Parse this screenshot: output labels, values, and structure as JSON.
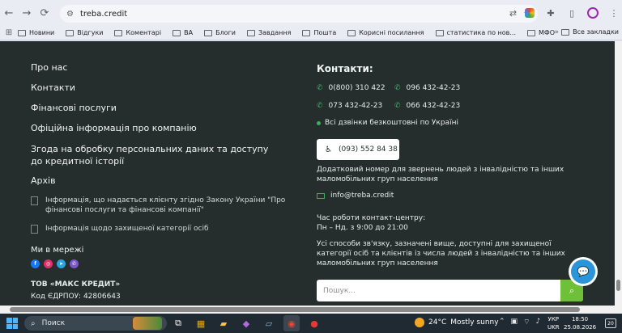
{
  "browser": {
    "url": "treba.credit",
    "bookmarks": [
      "Новини",
      "Відгуки",
      "Коментарі",
      "ВА",
      "Блоги",
      "Завдання",
      "Пошта",
      "Корисні посилання",
      "статистика по нов...",
      "МФО"
    ],
    "more": "»",
    "all_bookmarks": "Все закладки"
  },
  "footer": {
    "menu": [
      "Про нас",
      "Контакти",
      "Фінансові послуги",
      "Офіційна інформація про компанію",
      "Згода на обробку персональних даних та доступу до кредитної історії",
      "Архів"
    ],
    "archive_links": [
      "Інформація, що надається клієнту згідно Закону України \"Про фінансові послуги та фінансові компанії\"",
      "Інформація щодо захищеної категорії осіб"
    ],
    "social_title": "Ми в мережі",
    "company_name": "ТОВ «МАКС КРЕДИТ»",
    "company_code": "Код ЄДРПОУ: 42806643"
  },
  "contacts": {
    "title": "Контакти:",
    "phones": [
      "0(800) 310 422",
      "096 432-42-23",
      "073 432-42-23",
      "066 432-42-23"
    ],
    "free_calls": "Всі дзвінки безкоштовні по Україні",
    "accessibility_phone": "(093) 552 84 38",
    "accessibility_note": "Додатковий номер для звернень людей з інвалідністю та інших маломобільних груп населення",
    "email": "info@treba.credit",
    "hours_title": "Час роботи контакт-центру:",
    "hours": "Пн – Нд. з 9:00 до 21:00",
    "protected_note": "Усі способи зв'язку, зазначені вище, доступні для захищеної категорії осіб та клієнтів із числа людей з інвалідністю та інших маломобільних груп населення",
    "search_placeholder": "Пошук..."
  },
  "taskbar": {
    "search": "Поиск",
    "weather_temp": "24°C",
    "weather_text": "Mostly sunny",
    "lang1": "УКР",
    "lang2": "UKR",
    "time": "18:50",
    "date": "25.08.2026",
    "notifications": "20"
  },
  "colors": {
    "footer_bg": "#252e2c",
    "accent_green": "#35b35a",
    "search_green": "#6fbf3a"
  }
}
